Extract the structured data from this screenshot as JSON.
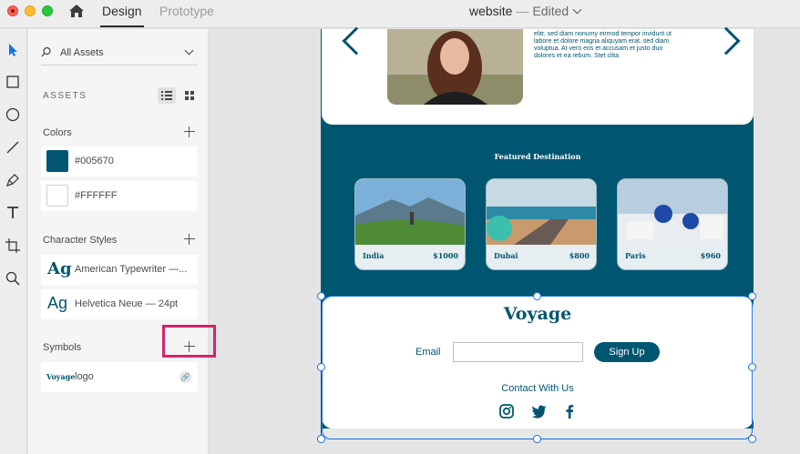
{
  "titlebar": {
    "tabs": [
      {
        "label": "Design",
        "active": true
      },
      {
        "label": "Prototype",
        "active": false
      }
    ],
    "doc_name": "website",
    "separator": "—",
    "doc_status": "Edited"
  },
  "toolbar": {
    "tools": [
      "select-icon",
      "rectangle-icon",
      "ellipse-icon",
      "line-icon",
      "pen-icon",
      "text-icon",
      "artboard-icon",
      "zoom-icon"
    ]
  },
  "assets_panel": {
    "filter_label": "All Assets",
    "header": "ASSETS",
    "colors": {
      "title": "Colors",
      "items": [
        {
          "hex": "#005670",
          "label": "#005670"
        },
        {
          "hex": "#FFFFFF",
          "label": "#FFFFFF"
        }
      ]
    },
    "character_styles": {
      "title": "Character Styles",
      "items": [
        {
          "glyph": "Ag",
          "label": "American Typewriter —..."
        },
        {
          "glyph": "Ag",
          "label": "Helvetica Neue — 24pt"
        }
      ]
    },
    "symbols": {
      "title": "Symbols",
      "items": [
        {
          "thumb": "Voyage",
          "label": "logo"
        }
      ]
    }
  },
  "canvas": {
    "intro_text": "elitr, sed diam nonumy eirmod tempor invidunt ut labore et dolore magna aliquyam erat, sed diam voluptua. At vero eos et accusam et justo duo dolores et ea rebum. Stet clita",
    "featured_title": "Featured Destination",
    "destinations": [
      {
        "name": "India",
        "price": "$1000"
      },
      {
        "name": "Dubai",
        "price": "$800"
      },
      {
        "name": "Paris",
        "price": "$960"
      }
    ],
    "footer": {
      "brand": "Voyage",
      "email_label": "Email",
      "email_value": "",
      "signup_label": "Sign Up",
      "contact_label": "Contact With Us",
      "social_icons": [
        "instagram-icon",
        "twitter-icon",
        "facebook-icon"
      ]
    }
  },
  "colors": {
    "accent": "#005670",
    "selection": "#1473e6",
    "highlight": "#d6226b"
  }
}
